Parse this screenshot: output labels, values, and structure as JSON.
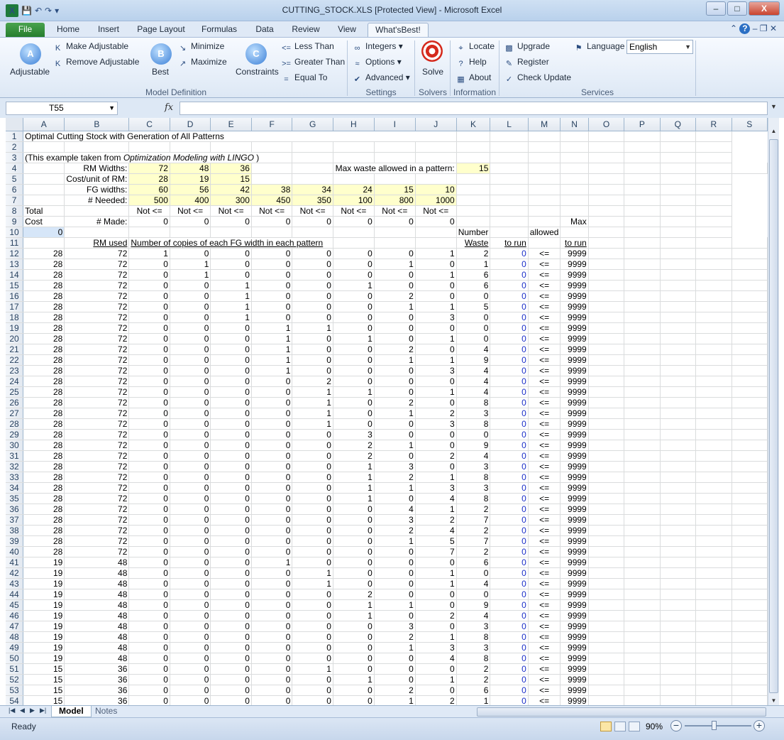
{
  "window": {
    "title": "CUTTING_STOCK.XLS  [Protected View]  -  Microsoft Excel",
    "minimize": "–",
    "restore": "□",
    "close": "X"
  },
  "tabs": [
    "File",
    "Home",
    "Insert",
    "Page Layout",
    "Formulas",
    "Data",
    "Review",
    "View",
    "What'sBest!"
  ],
  "ribbon": {
    "adjustable": "Adjustable",
    "make_adjustable": "Make Adjustable",
    "remove_adjustable": "Remove Adjustable",
    "best": "Best",
    "minimize": "Minimize",
    "maximize": "Maximize",
    "constraints": "Constraints",
    "less_than": "Less Than",
    "greater_than": "Greater Than",
    "equal_to": "Equal To",
    "integers": "Integers",
    "options": "Options",
    "advanced": "Advanced",
    "solve": "Solve",
    "locate": "Locate",
    "help": "Help",
    "about": "About",
    "upgrade": "Upgrade",
    "register": "Register",
    "check_update": "Check Update",
    "language": "Language",
    "language_value": "English",
    "groups": {
      "model_definition": "Model Definition",
      "settings": "Settings",
      "solvers": "Solvers",
      "information": "Information",
      "services": "Services"
    }
  },
  "formula_bar": {
    "name_box": "T55",
    "fx": "fx",
    "formula": ""
  },
  "columns": [
    "A",
    "B",
    "C",
    "D",
    "E",
    "F",
    "G",
    "H",
    "I",
    "J",
    "K",
    "L",
    "M",
    "N",
    "O",
    "P",
    "Q",
    "R",
    "S"
  ],
  "sheet": {
    "title": "Optimal Cutting Stock with Generation of All Patterns",
    "source_prefix": "(This example taken from ",
    "source_book": "Optimization Modeling with LINGO",
    "source_suffix": " )",
    "rm_widths_label": "RM Widths:",
    "rm_widths": [
      "72",
      "48",
      "36"
    ],
    "max_waste_label": "Max waste allowed in a pattern:",
    "max_waste": "15",
    "cost_label": "Cost/unit of RM:",
    "costs": [
      "28",
      "19",
      "15"
    ],
    "fg_widths_label": "FG widths:",
    "fg_widths": [
      "60",
      "56",
      "42",
      "38",
      "34",
      "24",
      "15",
      "10"
    ],
    "needed_label": "# Needed:",
    "needed": [
      "500",
      "400",
      "300",
      "450",
      "350",
      "100",
      "800",
      "1000"
    ],
    "total_label": "Total",
    "not_le": "Not <=",
    "cost_word": "Cost",
    "made_label": "# Made:",
    "made": [
      "0",
      "0",
      "0",
      "0",
      "0",
      "0",
      "0",
      "0"
    ],
    "max_label": "Max",
    "total_cost": "0",
    "number_label": "Number",
    "allowed_label": "allowed",
    "rm_used_label": "RM used",
    "copies_label": "Number of copies of each FG width in each pattern",
    "waste_label": "Waste",
    "to_run_label": "to run",
    "to_run_label2": "to run",
    "le": "<=",
    "max_run": "9999",
    "patterns": [
      [
        28,
        72,
        1,
        0,
        0,
        0,
        0,
        0,
        0,
        1,
        2
      ],
      [
        28,
        72,
        0,
        1,
        0,
        0,
        0,
        0,
        1,
        0,
        1
      ],
      [
        28,
        72,
        0,
        1,
        0,
        0,
        0,
        0,
        0,
        1,
        6
      ],
      [
        28,
        72,
        0,
        0,
        1,
        0,
        0,
        1,
        0,
        0,
        6
      ],
      [
        28,
        72,
        0,
        0,
        1,
        0,
        0,
        0,
        2,
        0,
        0
      ],
      [
        28,
        72,
        0,
        0,
        1,
        0,
        0,
        0,
        1,
        1,
        5
      ],
      [
        28,
        72,
        0,
        0,
        1,
        0,
        0,
        0,
        0,
        3,
        0
      ],
      [
        28,
        72,
        0,
        0,
        0,
        1,
        1,
        0,
        0,
        0,
        0
      ],
      [
        28,
        72,
        0,
        0,
        0,
        1,
        0,
        1,
        0,
        1,
        0
      ],
      [
        28,
        72,
        0,
        0,
        0,
        1,
        0,
        0,
        2,
        0,
        4
      ],
      [
        28,
        72,
        0,
        0,
        0,
        1,
        0,
        0,
        1,
        1,
        9
      ],
      [
        28,
        72,
        0,
        0,
        0,
        1,
        0,
        0,
        0,
        3,
        4
      ],
      [
        28,
        72,
        0,
        0,
        0,
        0,
        2,
        0,
        0,
        0,
        4
      ],
      [
        28,
        72,
        0,
        0,
        0,
        0,
        1,
        1,
        0,
        1,
        4
      ],
      [
        28,
        72,
        0,
        0,
        0,
        0,
        1,
        0,
        2,
        0,
        8
      ],
      [
        28,
        72,
        0,
        0,
        0,
        0,
        1,
        0,
        1,
        2,
        3
      ],
      [
        28,
        72,
        0,
        0,
        0,
        0,
        1,
        0,
        0,
        3,
        8
      ],
      [
        28,
        72,
        0,
        0,
        0,
        0,
        0,
        3,
        0,
        0,
        0
      ],
      [
        28,
        72,
        0,
        0,
        0,
        0,
        0,
        2,
        1,
        0,
        9
      ],
      [
        28,
        72,
        0,
        0,
        0,
        0,
        0,
        2,
        0,
        2,
        4
      ],
      [
        28,
        72,
        0,
        0,
        0,
        0,
        0,
        1,
        3,
        0,
        3
      ],
      [
        28,
        72,
        0,
        0,
        0,
        0,
        0,
        1,
        2,
        1,
        8
      ],
      [
        28,
        72,
        0,
        0,
        0,
        0,
        0,
        1,
        1,
        3,
        3
      ],
      [
        28,
        72,
        0,
        0,
        0,
        0,
        0,
        1,
        0,
        4,
        8
      ],
      [
        28,
        72,
        0,
        0,
        0,
        0,
        0,
        0,
        4,
        1,
        2
      ],
      [
        28,
        72,
        0,
        0,
        0,
        0,
        0,
        0,
        3,
        2,
        7
      ],
      [
        28,
        72,
        0,
        0,
        0,
        0,
        0,
        0,
        2,
        4,
        2
      ],
      [
        28,
        72,
        0,
        0,
        0,
        0,
        0,
        0,
        1,
        5,
        7
      ],
      [
        28,
        72,
        0,
        0,
        0,
        0,
        0,
        0,
        0,
        7,
        2
      ],
      [
        19,
        48,
        0,
        0,
        0,
        1,
        0,
        0,
        0,
        0,
        6
      ],
      [
        19,
        48,
        0,
        0,
        0,
        0,
        1,
        0,
        0,
        1,
        0
      ],
      [
        19,
        48,
        0,
        0,
        0,
        0,
        1,
        0,
        0,
        1,
        4
      ],
      [
        19,
        48,
        0,
        0,
        0,
        0,
        0,
        2,
        0,
        0,
        0
      ],
      [
        19,
        48,
        0,
        0,
        0,
        0,
        0,
        1,
        1,
        0,
        9
      ],
      [
        19,
        48,
        0,
        0,
        0,
        0,
        0,
        1,
        0,
        2,
        4
      ],
      [
        19,
        48,
        0,
        0,
        0,
        0,
        0,
        0,
        3,
        0,
        3
      ],
      [
        19,
        48,
        0,
        0,
        0,
        0,
        0,
        0,
        2,
        1,
        8
      ],
      [
        19,
        48,
        0,
        0,
        0,
        0,
        0,
        0,
        1,
        3,
        3
      ],
      [
        19,
        48,
        0,
        0,
        0,
        0,
        0,
        0,
        0,
        4,
        8
      ],
      [
        15,
        36,
        0,
        0,
        0,
        0,
        1,
        0,
        0,
        0,
        2
      ],
      [
        15,
        36,
        0,
        0,
        0,
        0,
        0,
        1,
        0,
        1,
        2
      ],
      [
        15,
        36,
        0,
        0,
        0,
        0,
        0,
        0,
        2,
        0,
        6
      ],
      [
        15,
        36,
        0,
        0,
        0,
        0,
        0,
        0,
        1,
        2,
        1
      ]
    ],
    "run_value": "0"
  },
  "sheet_tabs": [
    "Model",
    "Notes"
  ],
  "status": {
    "ready": "Ready",
    "zoom": "90%",
    "zoom_percent": 90
  }
}
